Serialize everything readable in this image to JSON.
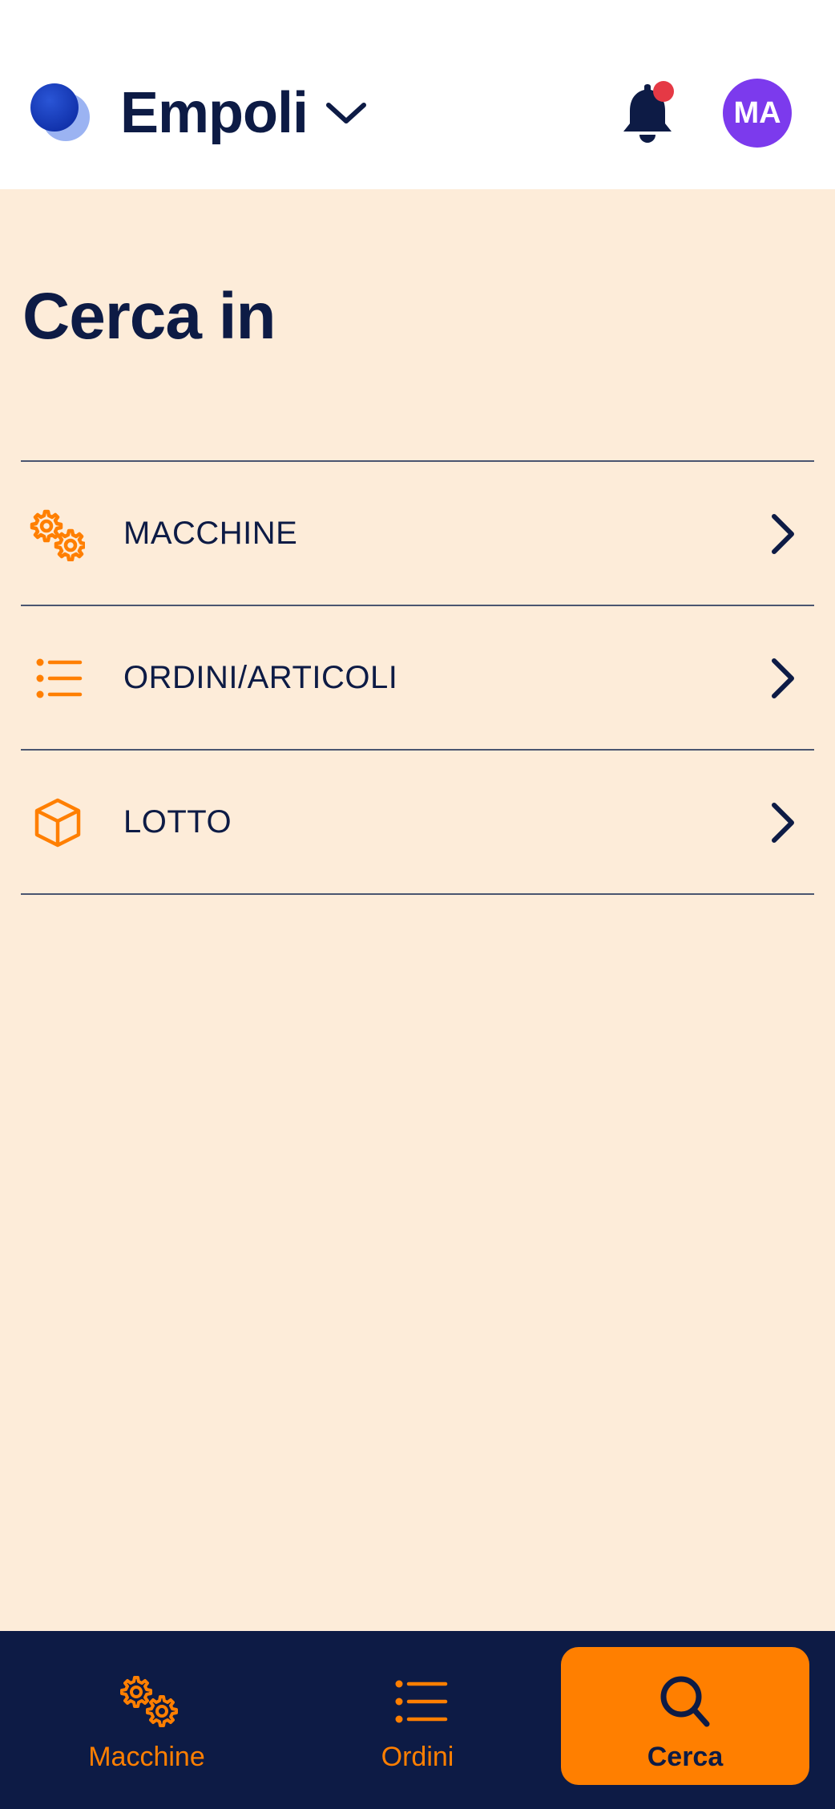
{
  "header": {
    "site_name": "Empoli",
    "avatar_initials": "MA",
    "notification_dot_color": "#e53945",
    "icons": {
      "logo": "app-logo",
      "site_chevron": "chevron-down-icon",
      "bell": "bell-icon"
    }
  },
  "page": {
    "title": "Cerca in"
  },
  "menu": {
    "items": [
      {
        "label": "MACCHINE",
        "icon": "gears-icon"
      },
      {
        "label": "ORDINI/ARTICOLI",
        "icon": "list-icon"
      },
      {
        "label": "LOTTO",
        "icon": "box-icon"
      }
    ]
  },
  "bottom_nav": {
    "items": [
      {
        "label": "Macchine",
        "icon": "gears-icon",
        "active": false
      },
      {
        "label": "Ordini",
        "icon": "list-icon",
        "active": false
      },
      {
        "label": "Cerca",
        "icon": "search-icon",
        "active": true
      }
    ]
  },
  "colors": {
    "background": "#fdecd9",
    "primary_dark": "#0d1b45",
    "accent": "#ff7f00",
    "avatar": "#7c3aed"
  }
}
